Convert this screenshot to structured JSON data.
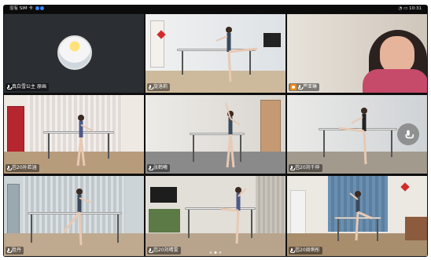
{
  "statusbar": {
    "left": "没有 SIM 卡",
    "time": "10:31"
  },
  "participants": [
    {
      "name": "真白雪公主",
      "tag": "原画",
      "self": true
    },
    {
      "name": "旋洛莉"
    },
    {
      "name": "芦亚琳",
      "host": true
    },
    {
      "name": "芭20孙若涵"
    },
    {
      "name": "张鹤曦"
    },
    {
      "name": "芭20刘千梓"
    },
    {
      "name": "胜丹"
    },
    {
      "name": "芭20刘晴雯"
    },
    {
      "name": "芭20周俐彤"
    }
  ],
  "page_indicator": {
    "count": 3,
    "active": 1
  },
  "colors": {
    "tile_bg": "#0b0b0b",
    "host_badge": "#ff8a00",
    "label_bg": "rgba(0,0,0,0.45)"
  }
}
